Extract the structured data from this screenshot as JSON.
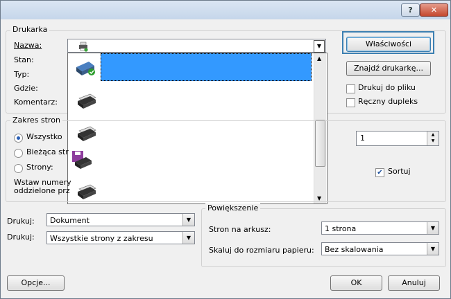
{
  "window": {
    "help_label": "?",
    "close_label": "✕"
  },
  "printer": {
    "group_title": "Drukarka",
    "name_label": "Nazwa:",
    "status_label": "Stan:",
    "type_label": "Typ:",
    "where_label": "Gdzie:",
    "comment_label": "Komentarz:",
    "properties_button": "Właściwości",
    "find_printer_button": "Znajdź drukarkę...",
    "print_to_file_label": "Drukuj do pliku",
    "manual_duplex_label": "Ręczny dupleks",
    "print_to_file_checked": false,
    "manual_duplex_checked": false
  },
  "page_range": {
    "group_title": "Zakres stron",
    "all_label": "Wszystko",
    "current_label": "Bieżąca str",
    "pages_label": "Strony:",
    "help_text_line1": "Wstaw numery",
    "help_text_line2": "oddzielone prz"
  },
  "copies": {
    "count_value": "1",
    "collate_label": "Sortuj",
    "collate_checked": true
  },
  "bottom": {
    "print_what_label": "Drukuj:",
    "print_what_value": "Dokument",
    "print_label": "Drukuj:",
    "print_value": "Wszystkie strony z zakresu",
    "zoom_group_title": "Powiększenie",
    "pages_per_sheet_label": "Stron na arkusz:",
    "pages_per_sheet_value": "1 strona",
    "scale_label": "Skaluj do rozmiaru papieru:",
    "scale_value": "Bez skalowania",
    "options_button": "Opcje...",
    "ok_button": "OK",
    "cancel_button": "Anuluj"
  },
  "colors": {
    "selection": "#3399ff",
    "focus_border": "#3c7fb1"
  }
}
